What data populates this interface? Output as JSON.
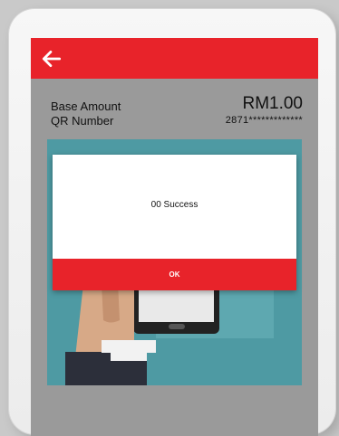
{
  "header": {
    "back_icon": "arrow-left-icon",
    "bar_color": "#e8232a"
  },
  "details": {
    "base_amount_label": "Base Amount",
    "base_amount_value": "RM1.00",
    "qr_number_label": "QR Number",
    "qr_number_value": "2871*************"
  },
  "dialog": {
    "message": "00 Success",
    "ok_label": "OK"
  },
  "colors": {
    "accent": "#e8232a",
    "illustration_bg": "#4e9aa3",
    "screen_bg": "#9a9a9a"
  }
}
